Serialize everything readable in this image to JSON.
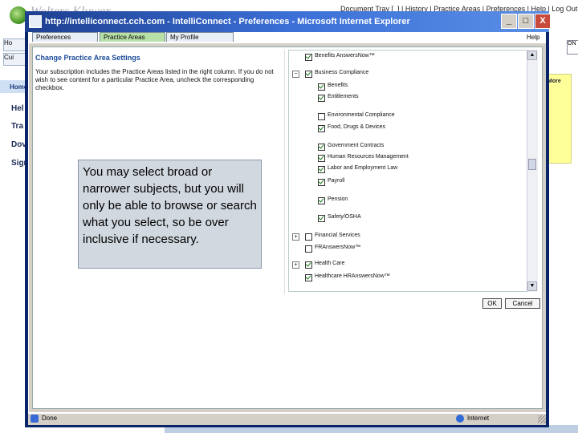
{
  "background_page": {
    "brand": "Wolters Kluwer",
    "top_nav": [
      "Document Tray [_]",
      "History",
      "Practice Areas",
      "Preferences",
      "Help",
      "Log Out"
    ],
    "left_tabs": [
      "Ho",
      "Cui"
    ],
    "nav_label": "Home",
    "side_items": [
      "Hel",
      "Tra",
      "Dov",
      "Sign"
    ],
    "right_panel_text": "More",
    "right_box_text": "ON"
  },
  "window": {
    "title": "http://intelliconnect.cch.com - IntelliConnect - Preferences - Microsoft Internet Explorer",
    "controls": {
      "minimize": "_",
      "maximize": "□",
      "close": "X"
    }
  },
  "tabs": [
    "Preferences",
    "Practice Areas",
    "My Profile"
  ],
  "help": "Help",
  "left_panel": {
    "title": "Change Practice Area Settings",
    "description": "Your subscription includes the Practice Areas listed in the right column. If you do not wish to see content for a particular Practice Area, uncheck the corresponding checkbox."
  },
  "practice_areas": [
    {
      "label": "Benefits AnswersNow™",
      "checked": true,
      "expander": "",
      "indent": 1
    },
    {
      "label": "Business Compliance",
      "checked": true,
      "expander": "−",
      "indent": 1
    },
    {
      "label": "Benefits",
      "checked": true,
      "expander": "",
      "indent": 2
    },
    {
      "label": "Entitlements",
      "checked": true,
      "expander": "",
      "indent": 2
    },
    {
      "label": "Environmental Compliance",
      "checked": false,
      "expander": "",
      "indent": 2
    },
    {
      "label": "Food, Drugs & Devices",
      "checked": true,
      "expander": "",
      "indent": 2
    },
    {
      "label": "Government Contracts",
      "checked": true,
      "expander": "",
      "indent": 2
    },
    {
      "label": "Human Resources Management",
      "checked": true,
      "expander": "",
      "indent": 2
    },
    {
      "label": "Labor and Employment Law",
      "checked": true,
      "expander": "",
      "indent": 2
    },
    {
      "label": "Payroll",
      "checked": true,
      "expander": "",
      "indent": 2
    },
    {
      "label": "Pension",
      "checked": true,
      "expander": "",
      "indent": 2
    },
    {
      "label": "Safety/OSHA",
      "checked": true,
      "expander": "",
      "indent": 2
    },
    {
      "label": "Financial Services",
      "checked": false,
      "expander": "+",
      "indent": 1
    },
    {
      "label": "FRAnswersNow™",
      "checked": false,
      "expander": "",
      "indent": 1
    },
    {
      "label": "Health Care",
      "checked": true,
      "expander": "+",
      "indent": 1
    },
    {
      "label": "Healthcare HRAnswersNow™",
      "checked": true,
      "expander": "",
      "indent": 1
    }
  ],
  "buttons": {
    "ok": "OK",
    "cancel": "Cancel"
  },
  "tooltip": "You may select broad or narrower subjects, but you will only be able to browse or search what you select, so be over inclusive if necessary.",
  "status": {
    "left": "Done",
    "zone": "Internet"
  },
  "colors": {
    "titlebar": "#2a5bc4",
    "active_tab": "#b7e0a8",
    "tooltip_bg": "#d2d8e0",
    "heading": "#1a4a9a",
    "highlight_panel": "#ffff99"
  }
}
